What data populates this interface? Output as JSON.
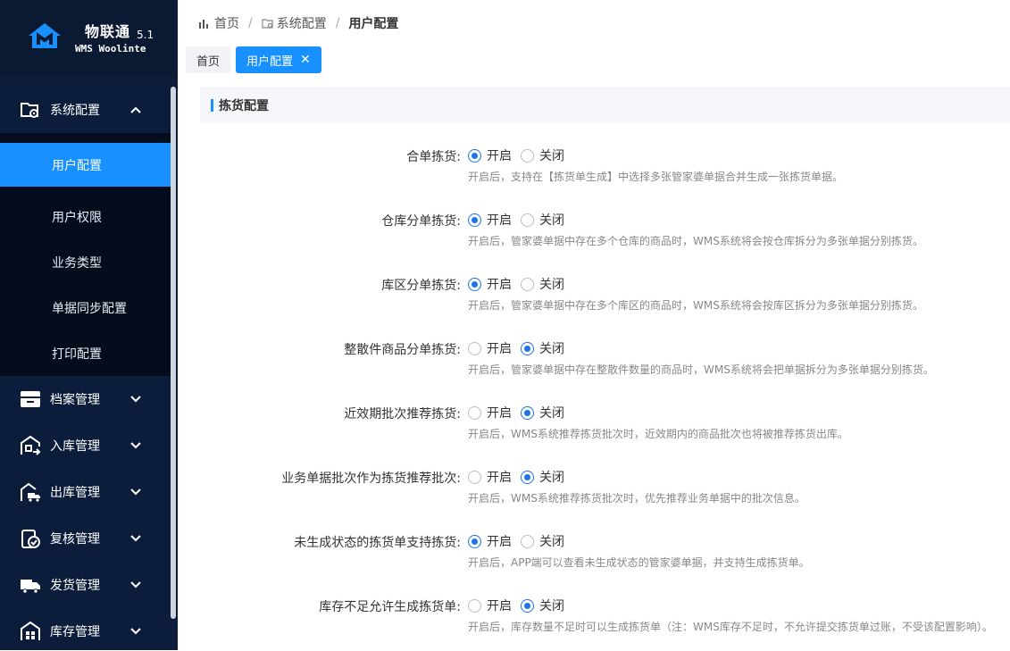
{
  "logo": {
    "title": "物联通",
    "version": "5.1",
    "subtitle": "WMS Woolinte"
  },
  "breadcrumb": [
    "首页",
    "系统配置",
    "用户配置"
  ],
  "tabs": [
    {
      "label": "首页"
    },
    {
      "label": "用户配置"
    }
  ],
  "sidebar": {
    "system": {
      "label": "系统配置",
      "items": [
        "用户配置",
        "用户权限",
        "业务类型",
        "单据同步配置",
        "打印配置"
      ]
    },
    "groups": [
      "档案管理",
      "入库管理",
      "出库管理",
      "复核管理",
      "发货管理",
      "库存管理"
    ]
  },
  "section": {
    "title": "拣货配置"
  },
  "options": {
    "on": "开启",
    "off": "关闭"
  },
  "settings": [
    {
      "label": "合单拣货:",
      "value": "on",
      "desc": "开启后，支持在【拣货单生成】中选择多张管家婆单据合并生成一张拣货单据。"
    },
    {
      "label": "仓库分单拣货:",
      "value": "on",
      "desc": "开启后，管家婆单据中存在多个仓库的商品时，WMS系统将会按仓库拆分为多张单据分别拣货。"
    },
    {
      "label": "库区分单拣货:",
      "value": "on",
      "desc": "开启后，管家婆单据中存在多个库区的商品时，WMS系统将会按库区拆分为多张单据分别拣货。"
    },
    {
      "label": "整散件商品分单拣货:",
      "value": "off",
      "desc": "开启后，管家婆单据中存在整散件数量的商品时，WMS系统将会把单据拆分为多张单据分别拣货。"
    },
    {
      "label": "近效期批次推荐拣货:",
      "value": "off",
      "desc": "开启后，WMS系统推荐拣货批次时，近效期内的商品批次也将被推荐拣货出库。"
    },
    {
      "label": "业务单据批次作为拣货推荐批次:",
      "value": "off",
      "desc": "开启后，WMS系统推荐拣货批次时，优先推荐业务单据中的批次信息。"
    },
    {
      "label": "未生成状态的拣货单支持拣货:",
      "value": "on",
      "desc": "开启后，APP端可以查看未生成状态的管家婆单据，并支持生成拣货单。"
    },
    {
      "label": "库存不足允许生成拣货单:",
      "value": "off",
      "desc": "开启后，库存数量不足时可以生成拣货单（注：WMS库存不足时，不允许提交拣货单过账，不受该配置影响）。"
    }
  ]
}
